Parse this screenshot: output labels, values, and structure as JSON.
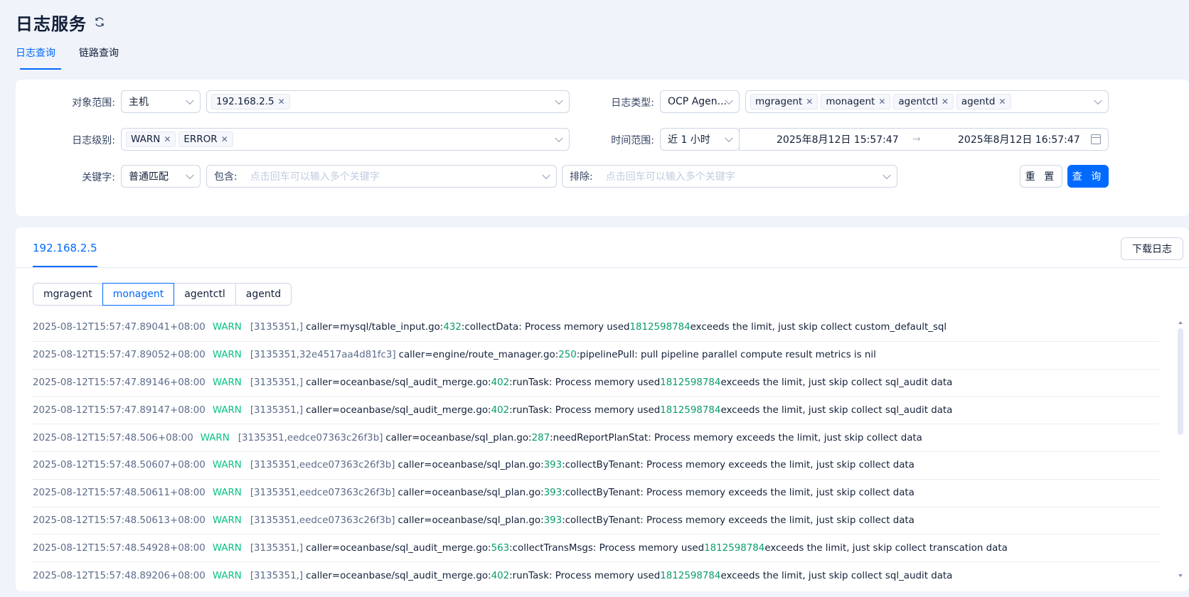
{
  "header": {
    "title": "日志服务"
  },
  "tabs": [
    {
      "label": "日志查询"
    },
    {
      "label": "链路查询"
    }
  ],
  "filters": {
    "scope_label": "对象范围:",
    "scope_value": "主机",
    "hosts": [
      "192.168.2.5"
    ],
    "log_type_label": "日志类型:",
    "log_type_value": "OCP Agen...",
    "log_components": [
      "mgragent",
      "monagent",
      "agentctl",
      "agentd"
    ],
    "level_label": "日志级别:",
    "levels": [
      "WARN",
      "ERROR"
    ],
    "time_label": "时间范围:",
    "time_preset": "近 1 小时",
    "time_start": "2025年8月12日 15:57:47",
    "time_sep": "→",
    "time_end": "2025年8月12日 16:57:47",
    "keyword_label": "关键字:",
    "keyword_mode": "普通匹配",
    "include_label": "包含:",
    "include_placeholder": "点击回车可以输入多个关键字",
    "exclude_label": "排除:",
    "exclude_placeholder": "点击回车可以输入多个关键字",
    "reset_label": "重 置",
    "query_label": "查 询"
  },
  "results": {
    "host_tab": "192.168.2.5",
    "download_label": "下载日志",
    "components": [
      "mgragent",
      "monagent",
      "agentctl",
      "agentd"
    ],
    "active_component": "monagent",
    "logs": [
      {
        "ts": "2025-08-12T15:57:47.89041+08:00",
        "level": "WARN",
        "ctx": "[3135351,]",
        "pre": "caller=mysql/table_input.go:",
        "line": "432",
        "mid": ":collectData: Process memory used ",
        "num": "1812598784",
        "post": " exceeds the limit, just skip collect custom_default_sql"
      },
      {
        "ts": "2025-08-12T15:57:47.89052+08:00",
        "level": "WARN",
        "ctx": "[3135351,32e4517aa4d81fc3]",
        "pre": "caller=engine/route_manager.go:",
        "line": "250",
        "mid": ":pipelinePull: pull pipeline parallel compute result metrics is nil",
        "num": "",
        "post": ""
      },
      {
        "ts": "2025-08-12T15:57:47.89146+08:00",
        "level": "WARN",
        "ctx": "[3135351,]",
        "pre": "caller=oceanbase/sql_audit_merge.go:",
        "line": "402",
        "mid": ":runTask: Process memory used ",
        "num": "1812598784",
        "post": " exceeds the limit, just skip collect sql_audit data"
      },
      {
        "ts": "2025-08-12T15:57:47.89147+08:00",
        "level": "WARN",
        "ctx": "[3135351,]",
        "pre": "caller=oceanbase/sql_audit_merge.go:",
        "line": "402",
        "mid": ":runTask: Process memory used ",
        "num": "1812598784",
        "post": " exceeds the limit, just skip collect sql_audit data"
      },
      {
        "ts": "2025-08-12T15:57:48.506+08:00",
        "level": "WARN",
        "ctx": "[3135351,eedce07363c26f3b]",
        "pre": "caller=oceanbase/sql_plan.go:",
        "line": "287",
        "mid": ":needReportPlanStat: Process memory exceeds the limit, just skip collect data",
        "num": "",
        "post": ""
      },
      {
        "ts": "2025-08-12T15:57:48.50607+08:00",
        "level": "WARN",
        "ctx": "[3135351,eedce07363c26f3b]",
        "pre": "caller=oceanbase/sql_plan.go:",
        "line": "393",
        "mid": ":collectByTenant: Process memory exceeds the limit, just skip collect data",
        "num": "",
        "post": ""
      },
      {
        "ts": "2025-08-12T15:57:48.50611+08:00",
        "level": "WARN",
        "ctx": "[3135351,eedce07363c26f3b]",
        "pre": "caller=oceanbase/sql_plan.go:",
        "line": "393",
        "mid": ":collectByTenant: Process memory exceeds the limit, just skip collect data",
        "num": "",
        "post": ""
      },
      {
        "ts": "2025-08-12T15:57:48.50613+08:00",
        "level": "WARN",
        "ctx": "[3135351,eedce07363c26f3b]",
        "pre": "caller=oceanbase/sql_plan.go:",
        "line": "393",
        "mid": ":collectByTenant: Process memory exceeds the limit, just skip collect data",
        "num": "",
        "post": ""
      },
      {
        "ts": "2025-08-12T15:57:48.54928+08:00",
        "level": "WARN",
        "ctx": "[3135351,]",
        "pre": "caller=oceanbase/sql_audit_merge.go:",
        "line": "563",
        "mid": ":collectTransMsgs: Process memory used ",
        "num": "1812598784",
        "post": " exceeds the limit, just skip collect transcation data"
      },
      {
        "ts": "2025-08-12T15:57:48.89206+08:00",
        "level": "WARN",
        "ctx": "[3135351,]",
        "pre": "caller=oceanbase/sql_audit_merge.go:",
        "line": "402",
        "mid": ":runTask: Process memory used ",
        "num": "1812598784",
        "post": " exceeds the limit, just skip collect sql_audit data"
      }
    ]
  },
  "colors": {
    "accent": "#006aff",
    "warn": "#0ac185",
    "number": "#0a9c6c"
  }
}
